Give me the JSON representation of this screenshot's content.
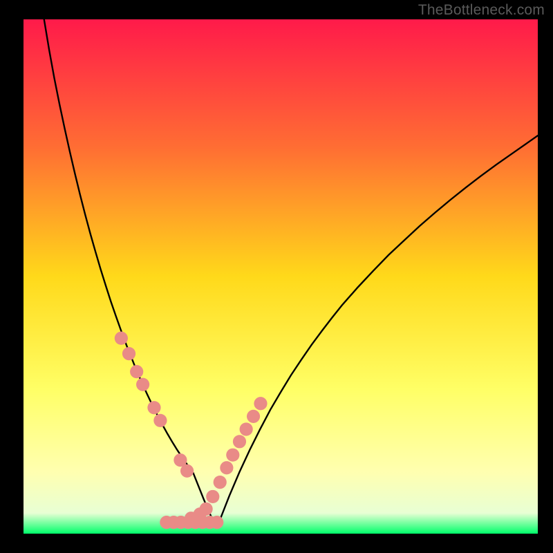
{
  "watermark": "TheBottleneck.com",
  "chart_data": {
    "type": "line",
    "title": "",
    "xlabel": "",
    "ylabel": "",
    "xlim": [
      0,
      100
    ],
    "ylim": [
      0,
      100
    ],
    "gradient_stops": [
      {
        "offset": 0,
        "color": "#ff1a4a"
      },
      {
        "offset": 25,
        "color": "#ff6e33"
      },
      {
        "offset": 50,
        "color": "#ffd91a"
      },
      {
        "offset": 72,
        "color": "#ffff66"
      },
      {
        "offset": 88,
        "color": "#ffffb0"
      },
      {
        "offset": 96,
        "color": "#e8ffd4"
      },
      {
        "offset": 100,
        "color": "#00ff6a"
      }
    ],
    "series": [
      {
        "name": "bottleneck-curve",
        "type": "line",
        "x": [
          4,
          5,
          6,
          7,
          8,
          9,
          10,
          11,
          12,
          13,
          14,
          15,
          16,
          17,
          18,
          19,
          20,
          21,
          22,
          23,
          24,
          25,
          26,
          27,
          28,
          29,
          30,
          31,
          32,
          33,
          34,
          35,
          36,
          37,
          38,
          40,
          42,
          44,
          46,
          48,
          50,
          52,
          54,
          56,
          58,
          60,
          62,
          65,
          68,
          71,
          74,
          77,
          80,
          83,
          86,
          89,
          92,
          95,
          98,
          100
        ],
        "y": [
          100,
          94,
          88.5,
          83.5,
          78.8,
          74.3,
          70,
          65.9,
          62,
          58.3,
          54.8,
          51.4,
          48.2,
          45.1,
          42.2,
          39.4,
          36.7,
          34.2,
          31.7,
          29.4,
          27.2,
          25.1,
          23.1,
          21.2,
          19.4,
          17.7,
          16.1,
          14.6,
          13.2,
          11.8,
          9.3,
          6.8,
          4.4,
          2.2,
          2.2,
          7.3,
          12,
          16.3,
          20.3,
          24.1,
          27.5,
          30.8,
          33.8,
          36.7,
          39.4,
          42,
          44.5,
          47.9,
          51.1,
          54.2,
          57,
          59.8,
          62.4,
          64.9,
          67.3,
          69.6,
          71.8,
          73.9,
          76,
          77.4
        ]
      },
      {
        "name": "left-branch-markers",
        "type": "scatter",
        "x": [
          19,
          20.5,
          22,
          23.2,
          25.4,
          26.6,
          30.5,
          31.8
        ],
        "y": [
          38,
          35,
          31.5,
          29,
          24.5,
          22,
          14.3,
          12.2
        ]
      },
      {
        "name": "right-branch-markers",
        "type": "scatter",
        "x": [
          32.6,
          34.3,
          35.5,
          36.8,
          38.2,
          39.5,
          40.7,
          42,
          43.3,
          44.7,
          46.1
        ],
        "y": [
          3,
          3.8,
          4.8,
          7.2,
          10,
          12.8,
          15.3,
          17.9,
          20.3,
          22.8,
          25.3
        ]
      },
      {
        "name": "bottom-horizontal-markers",
        "type": "scatter",
        "x": [
          27.8,
          29.2,
          30.6,
          32,
          33.4,
          34.8,
          36.2,
          37.6
        ],
        "y": [
          2.2,
          2.2,
          2.2,
          2.2,
          2.2,
          2.2,
          2.2,
          2.2
        ]
      }
    ]
  }
}
